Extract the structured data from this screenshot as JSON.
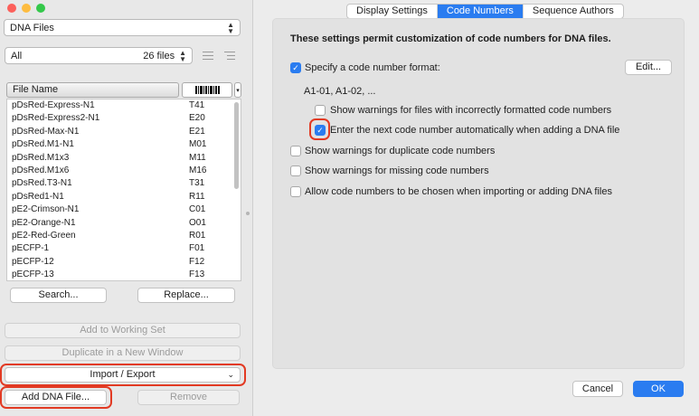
{
  "sidebar": {
    "source_popup": "DNA Files",
    "filter_popup": "All",
    "file_count": "26 files",
    "column_name": "File Name",
    "files": [
      {
        "name": "pDsRed-Express-N1",
        "code": "T41"
      },
      {
        "name": "pDsRed-Express2-N1",
        "code": "E20"
      },
      {
        "name": "pDsRed-Max-N1",
        "code": "E21"
      },
      {
        "name": "pDsRed.M1-N1",
        "code": "M01"
      },
      {
        "name": "pDsRed.M1x3",
        "code": "M11"
      },
      {
        "name": "pDsRed.M1x6",
        "code": "M16"
      },
      {
        "name": "pDsRed.T3-N1",
        "code": "T31"
      },
      {
        "name": "pDsRed1-N1",
        "code": "R11"
      },
      {
        "name": "pE2-Crimson-N1",
        "code": "C01"
      },
      {
        "name": "pE2-Orange-N1",
        "code": "O01"
      },
      {
        "name": "pE2-Red-Green",
        "code": "R01"
      },
      {
        "name": "pECFP-1",
        "code": "F01"
      },
      {
        "name": "pECFP-12",
        "code": "F12"
      },
      {
        "name": "pECFP-13",
        "code": "F13"
      }
    ],
    "search_label": "Search...",
    "replace_label": "Replace...",
    "add_working_set_label": "Add to Working Set",
    "duplicate_label": "Duplicate in a New Window",
    "import_export_label": "Import / Export",
    "add_dna_label": "Add DNA File...",
    "remove_label": "Remove"
  },
  "tabs": [
    "Display Settings",
    "Code Numbers",
    "Sequence Authors"
  ],
  "settings": {
    "heading": "These settings permit customization of code numbers for DNA files.",
    "specify_format": "Specify a code number format:",
    "edit_label": "Edit...",
    "format_example": "A1-01, A1-02, ...",
    "warn_incorrect": "Show warnings for files with incorrectly formatted code numbers",
    "auto_next": "Enter the next code number automatically when adding a DNA file",
    "warn_duplicate": "Show warnings for duplicate code numbers",
    "warn_missing": "Show warnings for missing code numbers",
    "allow_choose": "Allow code numbers to be chosen when importing or adding DNA files"
  },
  "footer": {
    "cancel_label": "Cancel",
    "ok_label": "OK"
  },
  "colors": {
    "accent": "#2a7cf0",
    "highlight": "#e23a23"
  }
}
